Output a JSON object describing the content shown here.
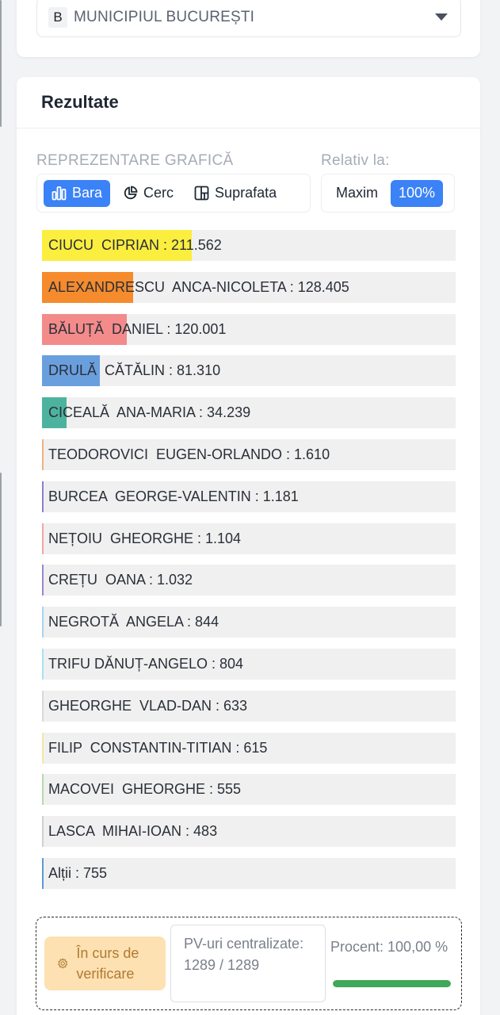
{
  "region_select": {
    "badge": "B",
    "value": "MUNICIPIUL BUCUREȘTI"
  },
  "results": {
    "title": "Rezultate",
    "graph_label": "REPREZENTARE GRAFICĂ",
    "relative_label": "Relativ la:",
    "view_modes": [
      {
        "label": "Bara",
        "icon": "bar-chart-icon",
        "active": true
      },
      {
        "label": "Cerc",
        "icon": "pie-chart-icon",
        "active": false
      },
      {
        "label": "Suprafata",
        "icon": "treemap-icon",
        "active": false
      }
    ],
    "relative_modes": [
      {
        "label": "Maxim",
        "active": false
      },
      {
        "label": "100%",
        "active": true
      }
    ],
    "candidates": [
      {
        "label": "CIUCU  CIPRIAN : 211.562",
        "value": 211562,
        "color": "#fbee3f"
      },
      {
        "label": "ALEXANDRESCU  ANCA-NICOLETA : 128.405",
        "value": 128405,
        "color": "#f58b2d"
      },
      {
        "label": "BĂLUȚĂ  DANIEL : 120.001",
        "value": 120001,
        "color": "#f38b8b"
      },
      {
        "label": "DRULĂ  CĂTĂLIN : 81.310",
        "value": 81310,
        "color": "#6a9fde"
      },
      {
        "label": "CICEALĂ  ANA-MARIA : 34.239",
        "value": 34239,
        "color": "#4db39e"
      },
      {
        "label": "TEODOROVICI  EUGEN-ORLANDO : 1.610",
        "value": 1610,
        "color": "#f2b27a"
      },
      {
        "label": "BURCEA  GEORGE-VALENTIN : 1.181",
        "value": 1181,
        "color": "#8b7fd0"
      },
      {
        "label": "NEȚOIU  GHEORGHE : 1.104",
        "value": 1104,
        "color": "#f2a5a5"
      },
      {
        "label": "CREȚU  OANA : 1.032",
        "value": 1032,
        "color": "#9b86c9"
      },
      {
        "label": "NEGROTĂ  ANGELA : 844",
        "value": 844,
        "color": "#a8d4f0"
      },
      {
        "label": "TRIFU DĂNUȚ-ANGELO : 804",
        "value": 804,
        "color": "#a6e3ee"
      },
      {
        "label": "GHEORGHE  VLAD-DAN : 633",
        "value": 633,
        "color": "#d9d9d9"
      },
      {
        "label": "FILIP  CONSTANTIN-TITIAN : 615",
        "value": 615,
        "color": "#f5e6a8"
      },
      {
        "label": "MACOVEI  GHEORGHE : 555",
        "value": 555,
        "color": "#b7d9b0"
      },
      {
        "label": "LASCA  MIHAI-IOAN : 483",
        "value": 483,
        "color": "#d0d0d0"
      },
      {
        "label": "Alții : 755",
        "value": 755,
        "color": "#5b9bd5"
      }
    ]
  },
  "status": {
    "verify_label": "În curs de verificare",
    "pv_label": "PV-uri centralizate: 1289 / 1289",
    "percent_label": "Procent: 100,00 %",
    "percent_value": 100
  },
  "colors": {
    "accent": "#3b82f6",
    "verify_bg": "#fde1b3",
    "progress": "#3fa85a"
  }
}
